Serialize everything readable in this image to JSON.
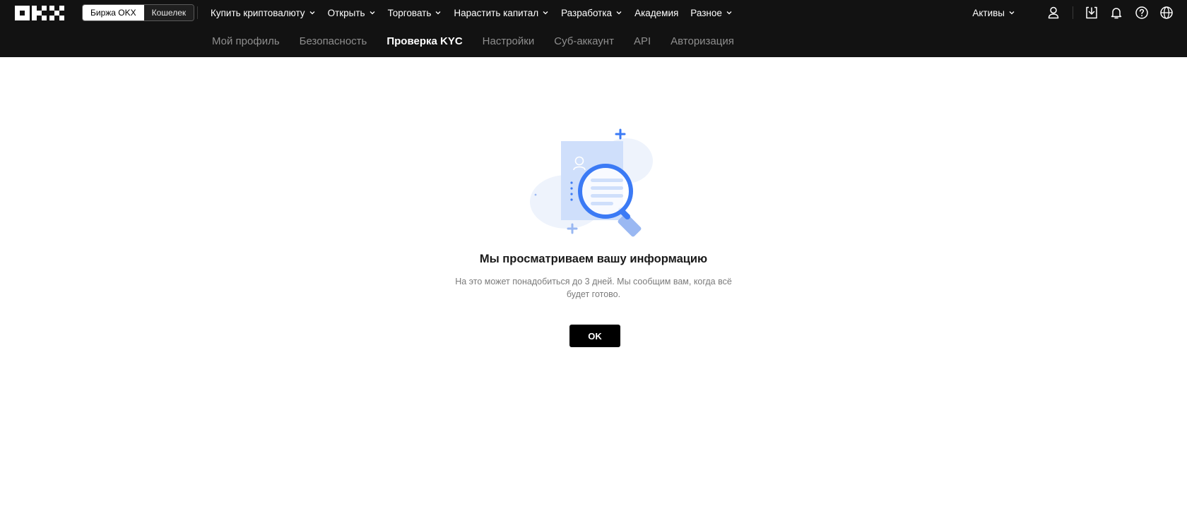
{
  "header": {
    "logo": "OKX",
    "segment": {
      "active": "Биржа OKX",
      "other": "Кошелек"
    },
    "nav": [
      {
        "label": "Купить криптовалюту",
        "has_chevron": true
      },
      {
        "label": "Открыть",
        "has_chevron": true
      },
      {
        "label": "Торговать",
        "has_chevron": true
      },
      {
        "label": "Нарастить капитал",
        "has_chevron": true
      },
      {
        "label": "Разработка",
        "has_chevron": true
      },
      {
        "label": "Академия",
        "has_chevron": false
      },
      {
        "label": "Разное",
        "has_chevron": true
      }
    ],
    "assets_label": "Активы",
    "icons": [
      "user-icon",
      "download-icon",
      "bell-icon",
      "help-icon",
      "globe-icon"
    ]
  },
  "subnav": {
    "items": [
      "Мой профиль",
      "Безопасность",
      "Проверка KYC",
      "Настройки",
      "Суб-аккаунт",
      "API",
      "Авторизация"
    ],
    "active": "Проверка KYC"
  },
  "main": {
    "title": "Мы просматриваем вашу информацию",
    "description": "На это может понадобиться до 3 дней. Мы сообщим вам, когда всё будет готово.",
    "ok_button": "OK"
  },
  "colors": {
    "topbar": "#121212",
    "accent_blue": "#3b7af5",
    "light_blue": "#dbe7fd",
    "button": "#000000"
  }
}
